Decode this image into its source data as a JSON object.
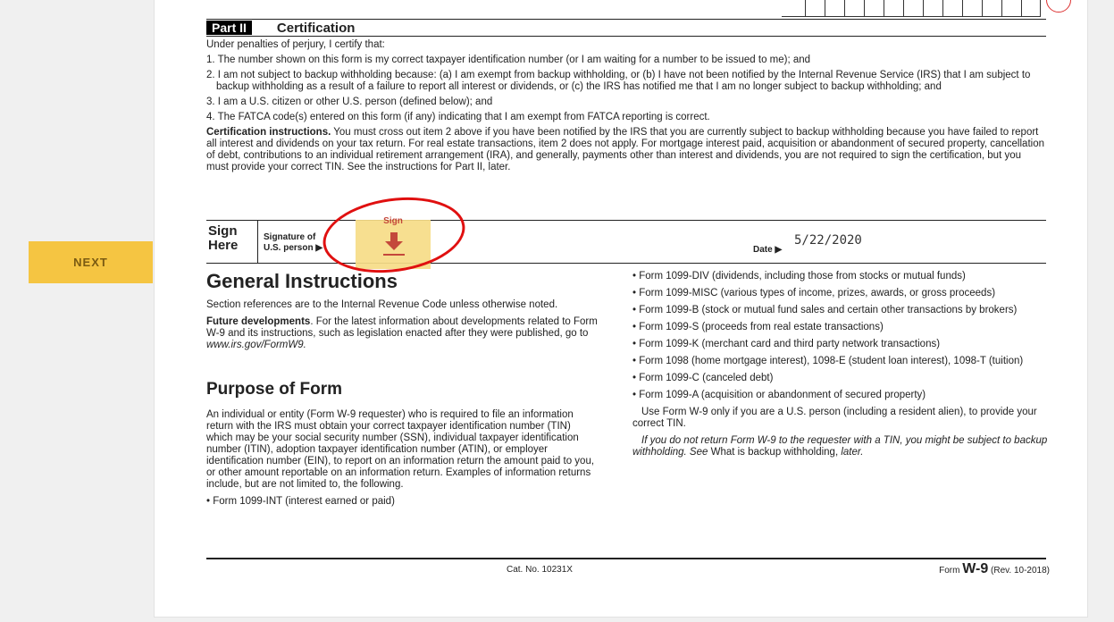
{
  "nav": {
    "next_label": "NEXT"
  },
  "part": {
    "label": "Part II",
    "title": "Certification"
  },
  "certification": {
    "intro": "Under penalties of perjury, I certify that:",
    "items": [
      "1. The number shown on this form is my correct taxpayer identification number (or I am waiting for a number to be issued to me); and",
      "2. I am not subject to backup withholding because: (a) I am exempt from backup withholding, or (b) I have not been notified by the Internal Revenue Service (IRS) that I am subject to backup withholding as a result of a failure to report all interest or dividends, or (c) the IRS has notified me that I am no longer subject to backup withholding; and",
      "3. I am a U.S. citizen or other U.S. person (defined below); and",
      "4. The FATCA code(s) entered on this form (if any) indicating that I am exempt from FATCA reporting is correct."
    ],
    "instructions_heading": "Certification instructions.",
    "instructions_text": " You must cross out item 2 above if you have been notified by the IRS that you are currently subject to backup withholding because you have failed to report all interest and dividends on your tax return. For real estate transactions, item 2 does not apply. For mortgage interest paid, acquisition or abandonment of secured property, cancellation of debt, contributions to an individual retirement arrangement (IRA), and generally, payments other than interest and dividends, you are not required to sign the certification, but you must provide your correct TIN. See the instructions for Part II, later."
  },
  "sign": {
    "here_line1": "Sign",
    "here_line2": "Here",
    "signature_label_1": "Signature of",
    "signature_label_2": "U.S. person ▶",
    "widget_label": "Sign",
    "date_label": "Date ▶",
    "date_value": "5/22/2020"
  },
  "general": {
    "heading": "General Instructions",
    "section_refs": "Section references are to the Internal Revenue Code unless otherwise noted.",
    "future_heading": "Future developments",
    "future_text": ". For the latest information about developments related to Form W-9 and its instructions, such as legislation enacted after they were published, go to ",
    "future_link": "www.irs.gov/FormW9."
  },
  "purpose": {
    "heading": "Purpose of Form",
    "text": "An individual or entity (Form W-9 requester) who is required to file an information return with the IRS must obtain your correct taxpayer identification number (TIN) which may be your social security number (SSN), individual taxpayer identification number (ITIN), adoption taxpayer identification number (ATIN), or employer identification number (EIN), to report on an information return the amount paid to you, or other amount reportable on an information return. Examples of information returns include, but are not limited to, the following.",
    "bullet_int": "• Form 1099-INT (interest earned or paid)"
  },
  "right_column": {
    "bullets": [
      "• Form 1099-DIV (dividends, including those from stocks or mutual funds)",
      "• Form 1099-MISC (various types of income, prizes, awards, or gross proceeds)",
      "• Form 1099-B (stock or mutual fund sales and certain other transactions by brokers)",
      "• Form 1099-S (proceeds from real estate transactions)",
      "• Form 1099-K (merchant card and third party network transactions)",
      "• Form 1098 (home mortgage interest), 1098-E (student loan interest), 1098-T (tuition)",
      "• Form 1099-C (canceled debt)",
      "• Form 1099-A (acquisition or abandonment of secured property)"
    ],
    "use_w9": "Use Form W-9 only if you are a U.S. person (including a resident alien), to provide your correct TIN.",
    "warning_italic": "If you do not return Form W-9 to the requester with a TIN, you might be subject to backup withholding. See ",
    "warning_normal": "What is backup withholding,",
    "warning_end": " later."
  },
  "footer": {
    "cat_no": "Cat. No. 10231X",
    "form_prefix": "Form",
    "form_name": "W-9",
    "form_rev": "(Rev. 10-2018)"
  },
  "colors": {
    "next_button": "#f5c542",
    "sign_widget": "#f7dd87",
    "annotation_circle": "#e01010"
  }
}
